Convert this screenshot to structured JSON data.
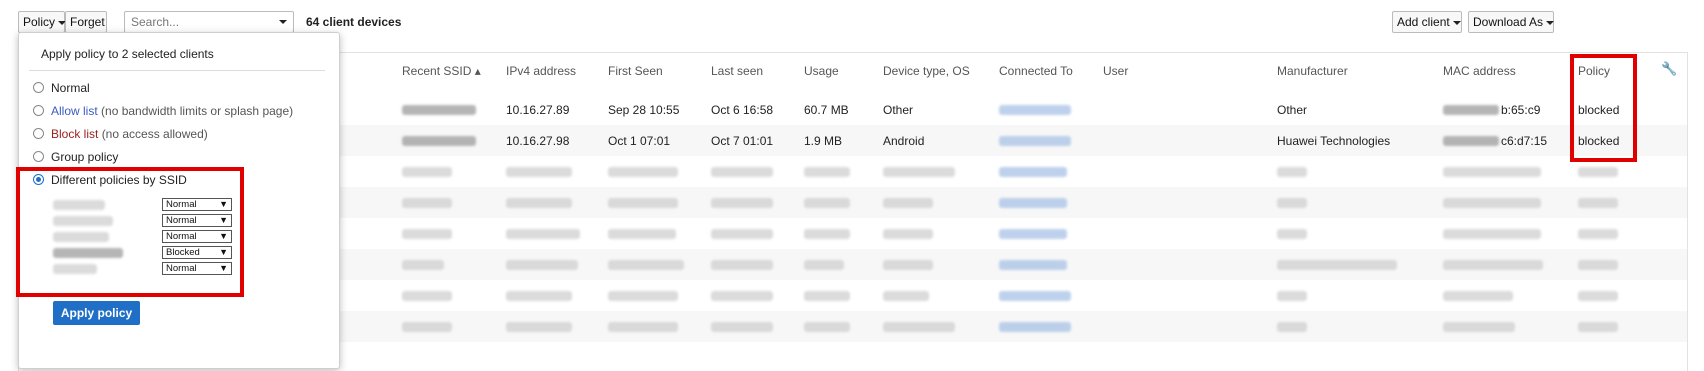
{
  "toolbar": {
    "policy_label": "Policy",
    "forget_label": "Forget",
    "search_placeholder": "Search...",
    "client_count": "64 client devices",
    "add_client_label": "Add client",
    "download_label": "Download As"
  },
  "table": {
    "columns": {
      "recent_ssid": "Recent SSID ▴",
      "ipv4": "IPv4 address",
      "first_seen": "First Seen",
      "last_seen": "Last seen",
      "usage": "Usage",
      "device_os": "Device type, OS",
      "connected_to": "Connected To",
      "user": "User",
      "manufacturer": "Manufacturer",
      "mac": "MAC address",
      "policy": "Policy"
    },
    "rows": [
      {
        "ipv4": "10.16.27.89",
        "first_seen": "Sep 28 10:55",
        "last_seen": "Oct 6 16:58",
        "usage": "60.7 MB",
        "device_os": "Other",
        "manufacturer": "Other",
        "mac_suffix": "b:65:c9",
        "policy": "blocked"
      },
      {
        "ipv4": "10.16.27.98",
        "first_seen": "Oct 1 07:01",
        "last_seen": "Oct 7 01:01",
        "usage": "1.9 MB",
        "device_os": "Android",
        "manufacturer": "Huawei Technologies",
        "mac_suffix": "c6:d7:15",
        "policy": "blocked"
      }
    ],
    "settings_icon": "wrench-icon"
  },
  "popup": {
    "title": "Apply policy to 2 selected clients",
    "options": {
      "normal": "Normal",
      "allow_list": "Allow list",
      "allow_note": "(no bandwidth limits or splash page)",
      "block_list": "Block list",
      "block_note": "(no access allowed)",
      "group_policy": "Group policy",
      "by_ssid": "Different policies by SSID"
    },
    "ssid_policies": [
      "Normal",
      "Normal",
      "Normal",
      "Blocked",
      "Normal"
    ],
    "apply_label": "Apply policy"
  },
  "colors": {
    "accent": "#1f6fc6",
    "highlight": "#e00000"
  }
}
